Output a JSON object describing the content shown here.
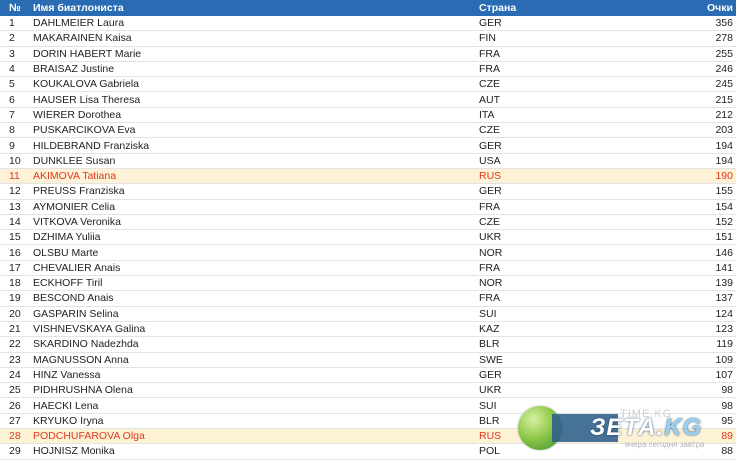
{
  "table": {
    "headers": {
      "num": "№",
      "name": "Имя биатлониста",
      "country": "Страна",
      "points": "Очки"
    },
    "rows": [
      {
        "num": "1",
        "name": "DAHLMEIER Laura",
        "country": "GER",
        "points": "356"
      },
      {
        "num": "2",
        "name": "MAKARAINEN Kaisa",
        "country": "FIN",
        "points": "278"
      },
      {
        "num": "3",
        "name": "DORIN HABERT Marie",
        "country": "FRA",
        "points": "255"
      },
      {
        "num": "4",
        "name": "BRAISAZ Justine",
        "country": "FRA",
        "points": "246"
      },
      {
        "num": "5",
        "name": "KOUKALOVA Gabriela",
        "country": "CZE",
        "points": "245"
      },
      {
        "num": "6",
        "name": "HAUSER Lisa Theresa",
        "country": "AUT",
        "points": "215"
      },
      {
        "num": "7",
        "name": "WIERER Dorothea",
        "country": "ITA",
        "points": "212"
      },
      {
        "num": "8",
        "name": "PUSKARCIKOVA Eva",
        "country": "CZE",
        "points": "203"
      },
      {
        "num": "9",
        "name": "HILDEBRAND Franziska",
        "country": "GER",
        "points": "194"
      },
      {
        "num": "10",
        "name": "DUNKLEE Susan",
        "country": "USA",
        "points": "194"
      },
      {
        "num": "11",
        "name": "AKIMOVA Tatiana",
        "country": "RUS",
        "points": "190",
        "highlight": true
      },
      {
        "num": "12",
        "name": "PREUSS Franziska",
        "country": "GER",
        "points": "155"
      },
      {
        "num": "13",
        "name": "AYMONIER Celia",
        "country": "FRA",
        "points": "154"
      },
      {
        "num": "14",
        "name": "VITKOVA Veronika",
        "country": "CZE",
        "points": "152"
      },
      {
        "num": "15",
        "name": "DZHIMA Yuliia",
        "country": "UKR",
        "points": "151"
      },
      {
        "num": "16",
        "name": "OLSBU Marte",
        "country": "NOR",
        "points": "146"
      },
      {
        "num": "17",
        "name": "CHEVALIER Anais",
        "country": "FRA",
        "points": "141"
      },
      {
        "num": "18",
        "name": "ECKHOFF Tiril",
        "country": "NOR",
        "points": "139"
      },
      {
        "num": "19",
        "name": "BESCOND Anais",
        "country": "FRA",
        "points": "137"
      },
      {
        "num": "20",
        "name": "GASPARIN Selina",
        "country": "SUI",
        "points": "124"
      },
      {
        "num": "21",
        "name": "VISHNEVSKAYA Galina",
        "country": "KAZ",
        "points": "123"
      },
      {
        "num": "22",
        "name": "SKARDINO Nadezhda",
        "country": "BLR",
        "points": "119"
      },
      {
        "num": "23",
        "name": "MAGNUSSON Anna",
        "country": "SWE",
        "points": "109"
      },
      {
        "num": "24",
        "name": "HINZ Vanessa",
        "country": "GER",
        "points": "107"
      },
      {
        "num": "25",
        "name": "PIDHRUSHNA Olena",
        "country": "UKR",
        "points": "98"
      },
      {
        "num": "26",
        "name": "HAECKI Lena",
        "country": "SUI",
        "points": "98"
      },
      {
        "num": "27",
        "name": "KRYUKO Iryna",
        "country": "BLR",
        "points": "95"
      },
      {
        "num": "28",
        "name": "PODCHUFAROVA Olga",
        "country": "RUS",
        "points": "89",
        "highlight": true
      },
      {
        "num": "29",
        "name": "HOJNISZ Monika",
        "country": "POL",
        "points": "88"
      }
    ]
  },
  "watermark": {
    "brand": "ЗЕТА.",
    "brand_suffix": "KG",
    "time_text": "TIME.KG",
    "slogan": "вчера сегодня завтра"
  },
  "colors": {
    "header_bg": "#2a6cb3",
    "highlight_bg": "#fdf1d6",
    "highlight_text": "#e03a1e"
  }
}
